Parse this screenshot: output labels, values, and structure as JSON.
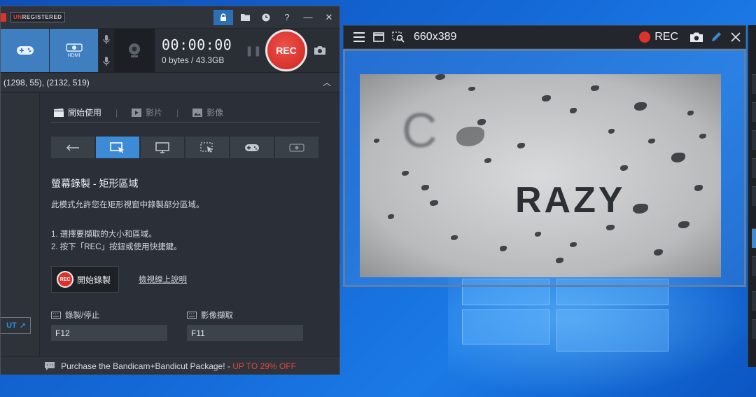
{
  "bandicam": {
    "badge_prefix": "UN",
    "badge_rest": "REGISTERED",
    "mode_hdmi_label": "HDMI",
    "timer": "00:00:00",
    "size": "0 bytes / 43.3GB",
    "rec_label": "REC",
    "coords": "(1298, 55), (2132, 519)",
    "tabs": [
      "開始使用",
      "影片",
      "影像"
    ],
    "mode_buttons": [
      "back",
      "rectangle-area",
      "fullscreen",
      "around-mouse",
      "game",
      "hdmi"
    ],
    "section_title": "螢幕錄製 - 矩形區域",
    "description": "此模式允許您在矩形視窗中錄製部分區域。",
    "steps": [
      "1. 選擇要擷取的大小和區域。",
      "2. 按下「REC」按鈕或使用快捷鍵。"
    ],
    "start_button": "開始錄製",
    "start_rec_badge": "REC",
    "help_link": "檢視線上說明",
    "hotkeys": [
      {
        "label": "錄製/停止",
        "value": "F12"
      },
      {
        "label": "影像擷取",
        "value": "F11"
      }
    ],
    "bandicut_label": "UT",
    "promo_text": "Purchase the Bandicam+Bandicut Package! - ",
    "promo_offer": "UP TO 29% OFF"
  },
  "overlay": {
    "dimensions": "660x389",
    "rec_label": "REC",
    "scene_text": "RAZY",
    "scene_c": "C"
  },
  "colors": {
    "accent": "#3d8bd6",
    "rec_red": "#e0322b",
    "promo_red": "#e0453c"
  }
}
